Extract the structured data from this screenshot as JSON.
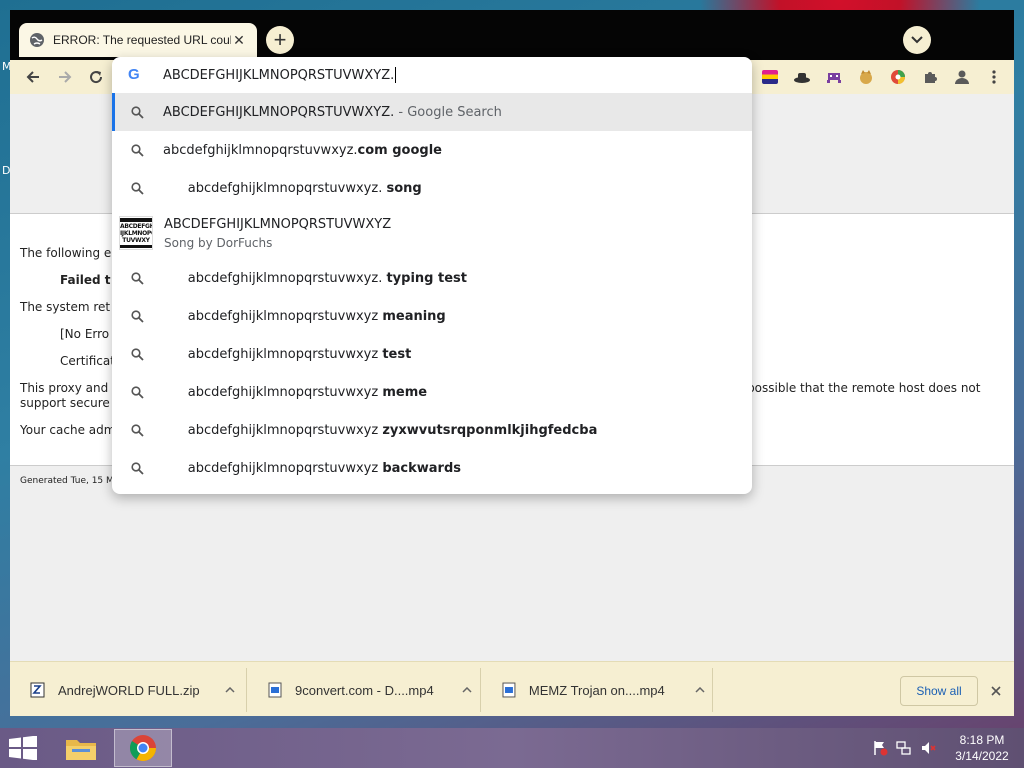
{
  "tab": {
    "title": "ERROR: The requested URL could not be retrieved"
  },
  "omnibox": {
    "input_value": "ABCDEFGHIJKLMNOPQRSTUVWXYZ.",
    "suggestions": [
      {
        "query": "ABCDEFGHIJKLMNOPQRSTUVWXYZ.",
        "suffix": "",
        "note": "- Google Search"
      },
      {
        "query": "abcdefghijklmnopqrstuvwxyz.",
        "suffix": "com google",
        "note": ""
      },
      {
        "query": "abcdefghijklmnopqrstuvwxyz. ",
        "suffix": "song",
        "note": ""
      },
      {
        "query": "abcdefghijklmnopqrstuvwxyz. ",
        "suffix": "typing test",
        "note": ""
      },
      {
        "query": "abcdefghijklmnopqrstuvwxyz ",
        "suffix": "meaning",
        "note": ""
      },
      {
        "query": "abcdefghijklmnopqrstuvwxyz ",
        "suffix": "test",
        "note": ""
      },
      {
        "query": "abcdefghijklmnopqrstuvwxyz ",
        "suffix": "meme",
        "note": ""
      },
      {
        "query": "abcdefghijklmnopqrstuvwxyz ",
        "suffix": "zyxwvutsrqponmlkjihgfedcba",
        "note": ""
      },
      {
        "query": "abcdefghijklmnopqrstuvwxyz ",
        "suffix": "backwards",
        "note": ""
      }
    ],
    "rich_result": {
      "title": "ABCDEFGHIJKLMNOPQRSTUVWXYZ",
      "subtitle": "Song by DorFuchs",
      "album_lines": [
        "ABCDEFGH",
        "IJKLMNOPQ",
        "TUVWXY"
      ]
    }
  },
  "page": {
    "line1": "The following e",
    "line2": "Failed t",
    "line3": "The system ret",
    "line4": "[No Erro",
    "line5": "Certificat",
    "line6a": "This proxy and",
    "line6b": "support secure",
    "line6c": "s possible that the remote host does not",
    "line7": "Your cache adm",
    "footer": "Generated Tue, 15 M"
  },
  "downloads": {
    "items": [
      {
        "name": "AndrejWORLD FULL.zip"
      },
      {
        "name": "9convert.com - D....mp4"
      },
      {
        "name": "MEMZ Trojan on....mp4"
      }
    ],
    "show_all": "Show all"
  },
  "taskbar": {
    "time": "8:18 PM",
    "date": "3/14/2022"
  },
  "desktop": {
    "edge_text_1": "M",
    "edge_text_2": "D"
  },
  "colors": {
    "accent": "#1a73e8",
    "toolbar_bg": "#f6efd2",
    "tabstrip_bg": "#050505"
  }
}
